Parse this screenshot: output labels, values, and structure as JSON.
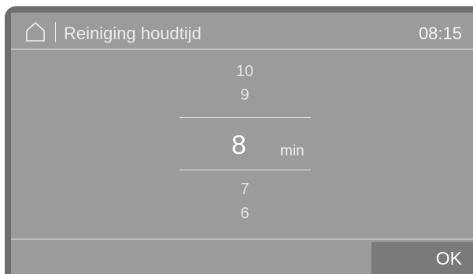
{
  "header": {
    "home_icon": "home-icon",
    "title": "Reiniging houdtijd",
    "time": "08:15"
  },
  "picker": {
    "above": [
      "10",
      "9"
    ],
    "selected": "8",
    "unit": "min",
    "below": [
      "7",
      "6"
    ]
  },
  "footer": {
    "ok_label": "OK"
  }
}
